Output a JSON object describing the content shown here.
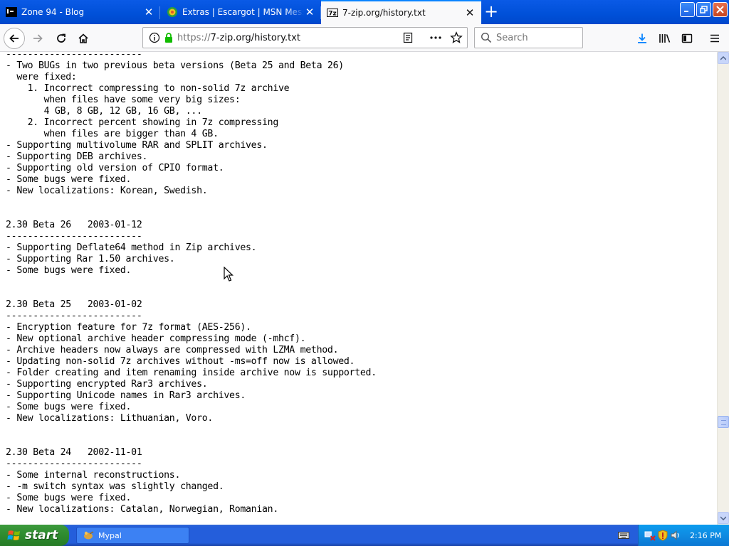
{
  "tabs": [
    {
      "title": "Zone 94 - Blog",
      "favicon": "terminal-icon",
      "active": false
    },
    {
      "title": "Extras | Escargot | MSN Messenger",
      "favicon": "escargot-icon",
      "active": false
    },
    {
      "title": "7-zip.org/history.txt",
      "favicon": "7z-icon",
      "favicon_text": "7z",
      "active": true
    }
  ],
  "address": {
    "protocol": "https://",
    "host_path": "7-zip.org/history.txt"
  },
  "search": {
    "placeholder": "Search"
  },
  "document": {
    "text": "-------------------------\n- Two BUGs in two previous beta versions (Beta 25 and Beta 26)\n  were fixed:\n    1. Incorrect compressing to non-solid 7z archive\n       when files have some very big sizes:\n       4 GB, 8 GB, 12 GB, 16 GB, ...\n    2. Incorrect percent showing in 7z compressing\n       when files are bigger than 4 GB.\n- Supporting multivolume RAR and SPLIT archives.\n- Supporting DEB archives.\n- Supporting old version of CPIO format.\n- Some bugs were fixed.\n- New localizations: Korean, Swedish.\n\n\n2.30 Beta 26   2003-01-12\n-------------------------\n- Supporting Deflate64 method in Zip archives.\n- Supporting Rar 1.50 archives.\n- Some bugs were fixed.\n\n\n2.30 Beta 25   2003-01-02\n-------------------------\n- Encryption feature for 7z format (AES-256).\n- New optional archive header compressing mode (-mhcf).\n- Archive headers now always are compressed with LZMA method.\n- Updating non-solid 7z archives without -ms=off now is allowed.\n- Folder creating and item renaming inside archive now is supported.\n- Supporting encrypted Rar3 archives.\n- Supporting Unicode names in Rar3 archives.\n- Some bugs were fixed.\n- New localizations: Lithuanian, Voro.\n\n\n2.30 Beta 24   2002-11-01\n-------------------------\n- Some internal reconstructions.\n- -m switch syntax was slightly changed.\n- Some bugs were fixed.\n- New localizations: Catalan, Norwegian, Romanian."
  },
  "taskbar": {
    "start_label": "start",
    "window_label": "Mypal",
    "clock": "2:16 PM"
  },
  "colors": {
    "titlebar": "#0050d8",
    "accent": "#0a84ff",
    "taskbar": "#245edb",
    "start": "#2e8b2e",
    "tray": "#0f8be2"
  }
}
